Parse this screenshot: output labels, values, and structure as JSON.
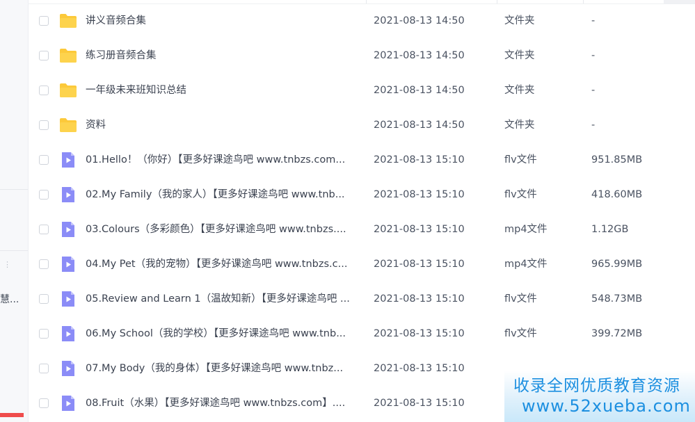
{
  "sidebar": {
    "truncated_label": "慧..."
  },
  "files": [
    {
      "name": "讲义音频合集",
      "date": "2021-08-13 14:50",
      "type": "文件夹",
      "size": "-",
      "icon": "folder-icon"
    },
    {
      "name": "练习册音频合集",
      "date": "2021-08-13 14:50",
      "type": "文件夹",
      "size": "-",
      "icon": "folder-icon"
    },
    {
      "name": "一年级未来班知识总结",
      "date": "2021-08-13 14:50",
      "type": "文件夹",
      "size": "-",
      "icon": "folder-icon"
    },
    {
      "name": "资料",
      "date": "2021-08-13 14:50",
      "type": "文件夹",
      "size": "-",
      "icon": "folder-icon"
    },
    {
      "name": "01.Hello！（你好）【更多好课途鸟吧 www.tnbzs.com...",
      "date": "2021-08-13 15:10",
      "type": "flv文件",
      "size": "951.85MB",
      "icon": "video-file-icon"
    },
    {
      "name": "02.My Family（我的家人）【更多好课途鸟吧 www.tnb...",
      "date": "2021-08-13 15:10",
      "type": "flv文件",
      "size": "418.60MB",
      "icon": "video-file-icon"
    },
    {
      "name": "03.Colours（多彩颜色）【更多好课途鸟吧 www.tnbzs....",
      "date": "2021-08-13 15:10",
      "type": "mp4文件",
      "size": "1.12GB",
      "icon": "video-file-icon"
    },
    {
      "name": "04.My Pet（我的宠物）【更多好课途鸟吧 www.tnbzs.c...",
      "date": "2021-08-13 15:10",
      "type": "mp4文件",
      "size": "965.99MB",
      "icon": "video-file-icon"
    },
    {
      "name": "05.Review and Learn 1（温故知新）【更多好课途鸟吧 ...",
      "date": "2021-08-13 15:10",
      "type": "flv文件",
      "size": "548.73MB",
      "icon": "video-file-icon"
    },
    {
      "name": "06.My School（我的学校）【更多好课途鸟吧 www.tnb...",
      "date": "2021-08-13 15:10",
      "type": "flv文件",
      "size": "399.72MB",
      "icon": "video-file-icon"
    },
    {
      "name": "07.My Body（我的身体）【更多好课途鸟吧 www.tnbz...",
      "date": "2021-08-13 15:10",
      "type": "",
      "size": "",
      "icon": "video-file-icon"
    },
    {
      "name": "08.Fruit（水果）【更多好课途鸟吧 www.tnbzs.com】....",
      "date": "2021-08-13 15:10",
      "type": "",
      "size": "",
      "icon": "video-file-icon"
    }
  ],
  "watermark": {
    "line1": "收录全网优质教育资源",
    "line2": "www.52xueba.com"
  },
  "colors": {
    "folder": "#fcc93a",
    "video_icon": "#8b8cf7",
    "watermark_text": "#1c8fe0",
    "sidebar_red": "#ef4c4c"
  }
}
